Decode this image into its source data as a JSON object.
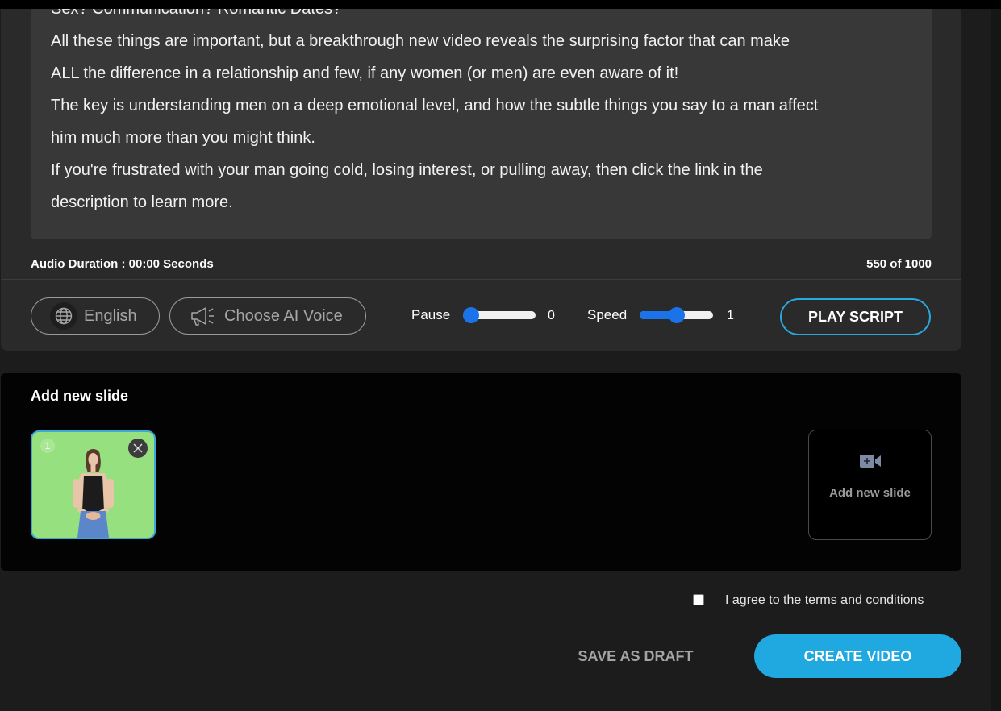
{
  "script": {
    "lines": [
      "Sex? Communication? Romantic Dates?",
      "All these things are important, but a breakthrough new video reveals the surprising factor that can make",
      "ALL the difference in a relationship and few, if any women (or men) are even aware of it!",
      "The key is understanding men on a deep emotional level, and how the subtle things you say to a man affect",
      "him much more than you might think.",
      "If you're frustrated with your man going cold, losing interest, or pulling away, then click the link in the",
      "description to learn more."
    ],
    "audio_duration": "Audio Duration : 00:00 Seconds",
    "char_count": "550 of 1000"
  },
  "controls": {
    "language": {
      "label": "English",
      "icon": "globe-icon"
    },
    "voice": {
      "label": "Choose AI Voice",
      "icon": "megaphone-icon"
    },
    "pause": {
      "label": "Pause",
      "value": "0",
      "level": 0
    },
    "speed": {
      "label": "Speed",
      "value": "1",
      "level": 0.5
    },
    "play_label": "PLAY SCRIPT",
    "accent_color": "#1a73e8"
  },
  "slides": {
    "title": "Add new slide",
    "items": [
      {
        "number": "1",
        "background": "#97e07f"
      }
    ],
    "add_label": "Add new slide",
    "add_icon": "video-camera-plus-icon"
  },
  "footer": {
    "agree_label": "I agree to the terms and conditions",
    "draft_label": "SAVE AS DRAFT",
    "create_label": "CREATE VIDEO",
    "primary_color": "#20a8e0"
  }
}
